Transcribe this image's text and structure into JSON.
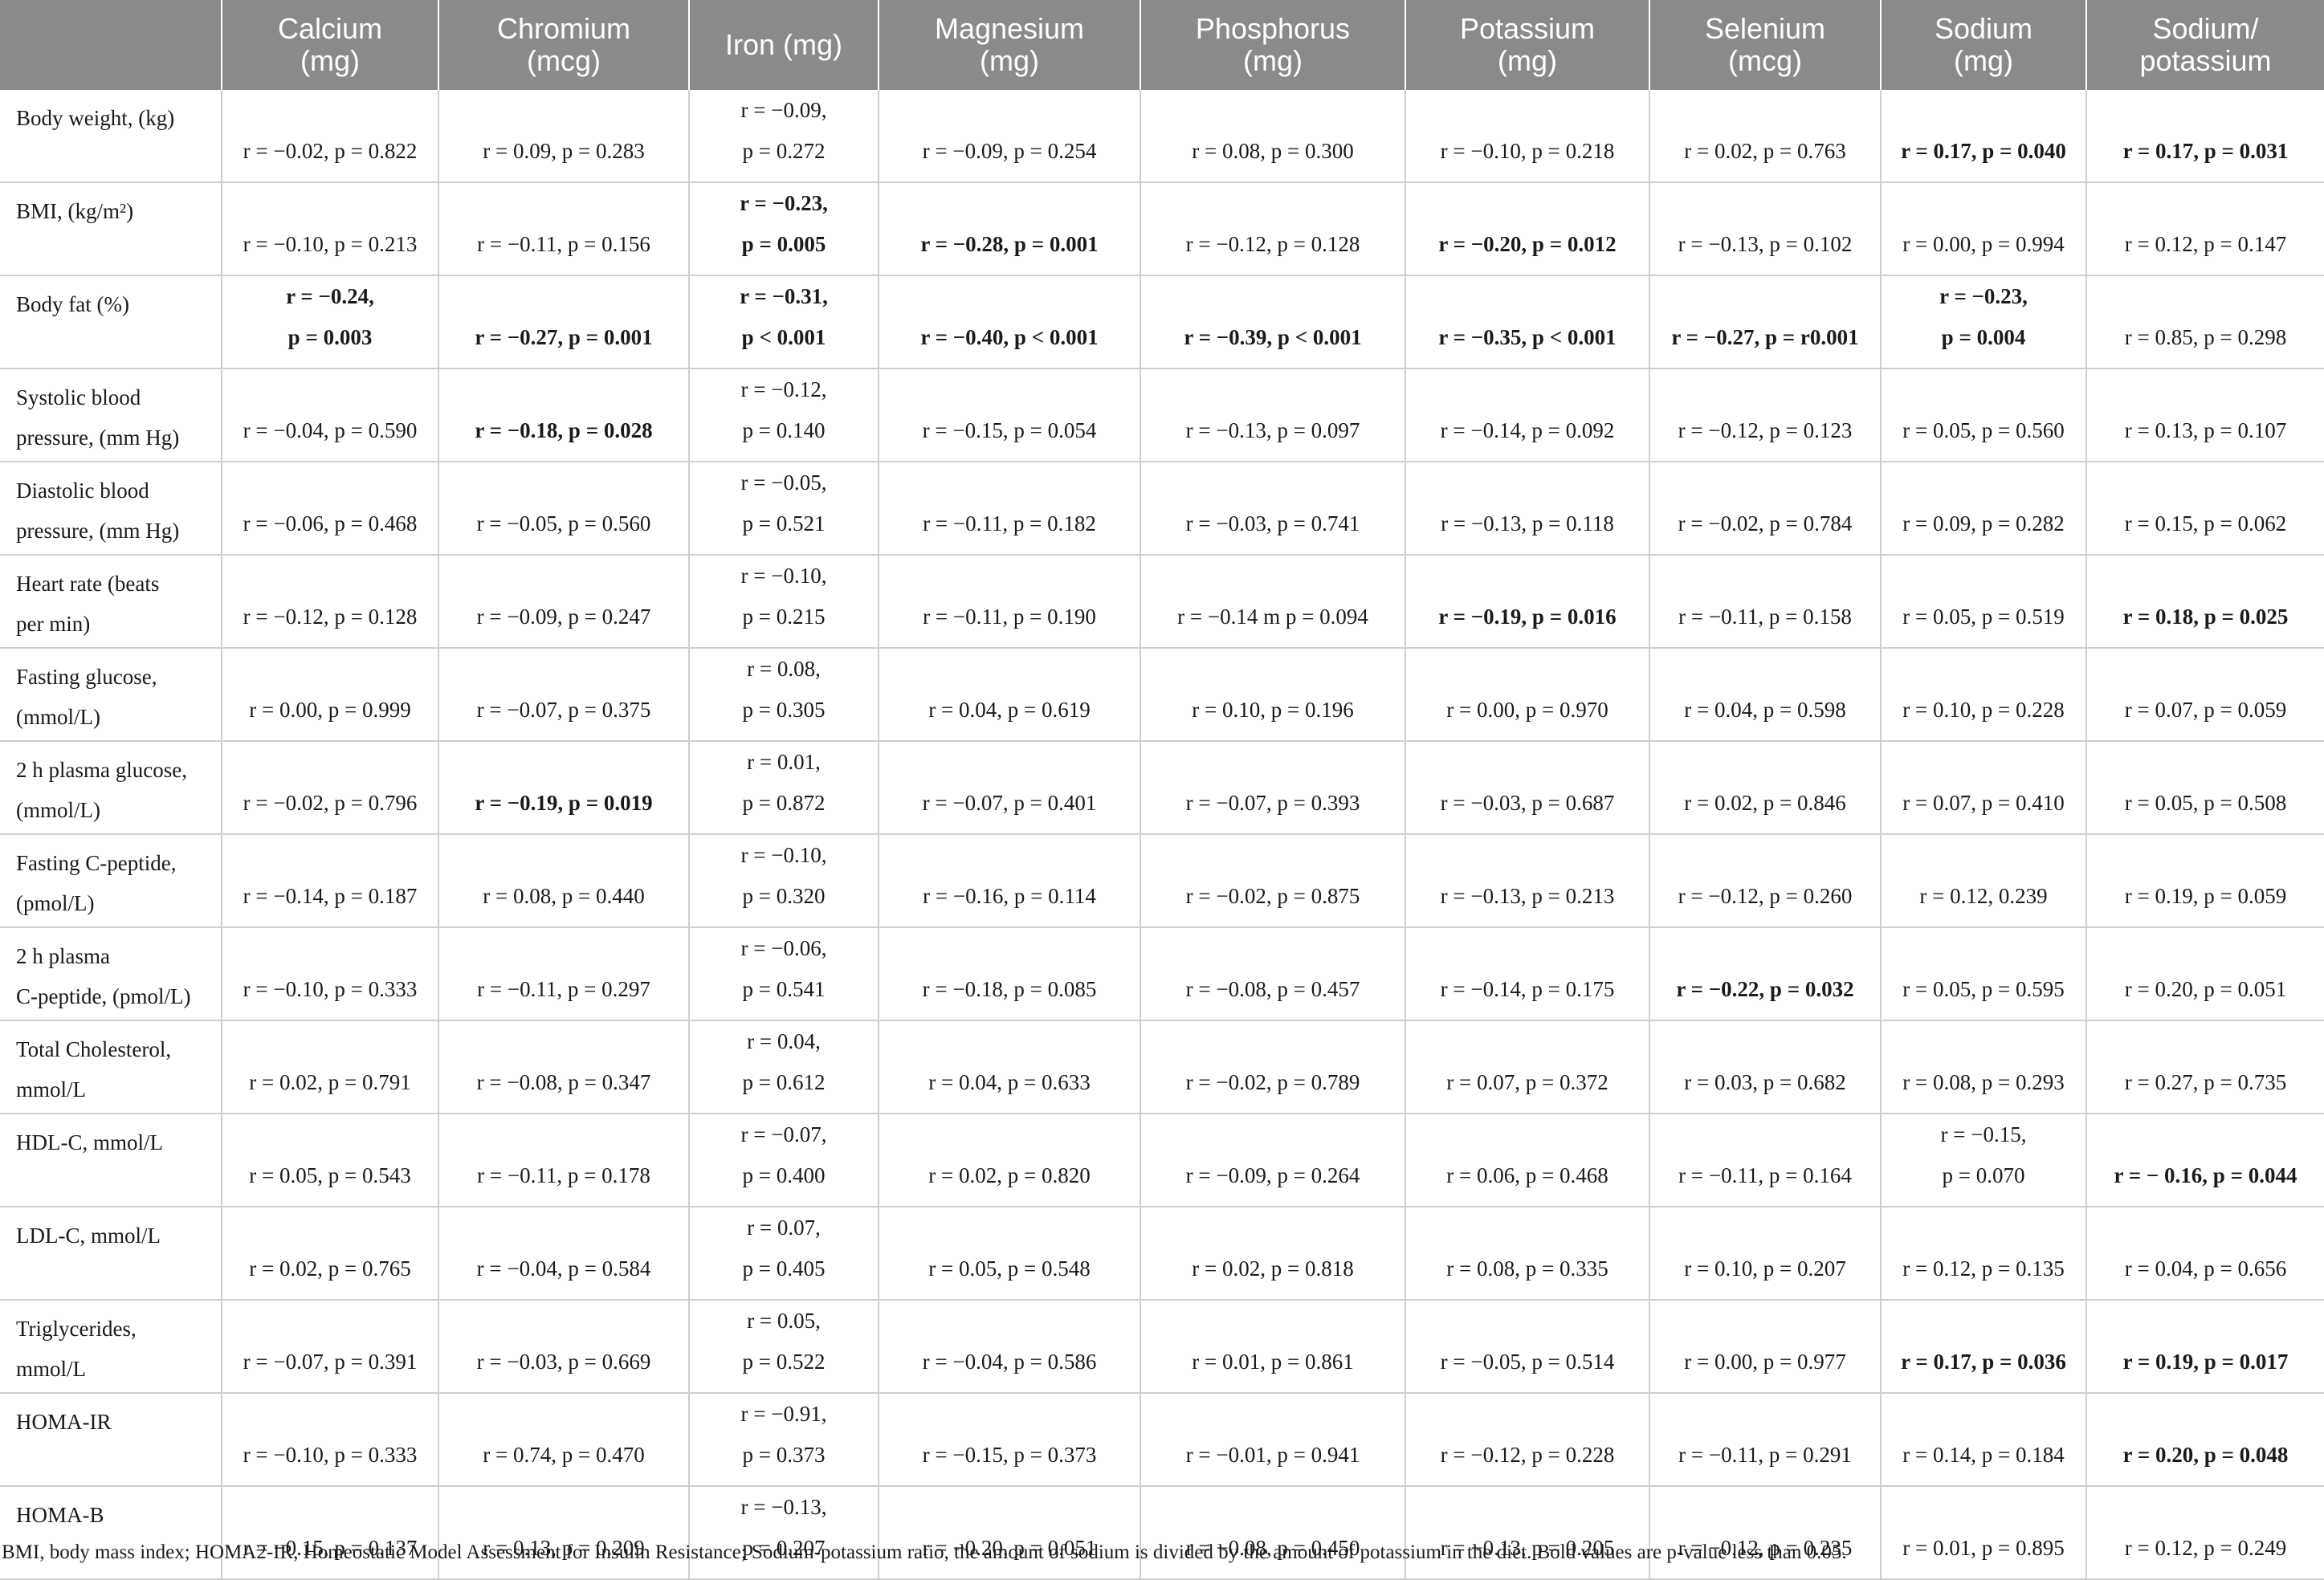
{
  "table": {
    "headers": [
      "",
      "Calcium\n(mg)",
      "Chromium\n(mcg)",
      "Iron (mg)",
      "Magnesium\n(mg)",
      "Phosphorus\n(mg)",
      "Potassium\n(mg)",
      "Selenium\n(mcg)",
      "Sodium\n(mg)",
      "Sodium/\npotassium"
    ],
    "rows": [
      {
        "label": "Body weight, (kg)",
        "cells": [
          {
            "text": "r = −0.02, p = 0.822",
            "bold": false,
            "split": false
          },
          {
            "text": "r = 0.09, p = 0.283",
            "bold": false,
            "split": false
          },
          {
            "text": "r = −0.09,\np = 0.272",
            "bold": false,
            "split": true
          },
          {
            "text": "r = −0.09, p = 0.254",
            "bold": false,
            "split": false
          },
          {
            "text": "r = 0.08, p = 0.300",
            "bold": false,
            "split": false
          },
          {
            "text": "r = −0.10, p = 0.218",
            "bold": false,
            "split": false
          },
          {
            "text": "r = 0.02, p = 0.763",
            "bold": false,
            "split": false
          },
          {
            "text": "r = 0.17, p = 0.040",
            "bold": true,
            "split": false
          },
          {
            "text": "r = 0.17, p = 0.031",
            "bold": true,
            "split": false
          }
        ]
      },
      {
        "label": "BMI, (kg/m²)",
        "cells": [
          {
            "text": "r = −0.10, p = 0.213",
            "bold": false,
            "split": false
          },
          {
            "text": "r = −0.11, p = 0.156",
            "bold": false,
            "split": false
          },
          {
            "text": "r = −0.23,\np = 0.005",
            "bold": true,
            "split": true
          },
          {
            "text": "r = −0.28, p = 0.001",
            "bold": true,
            "split": false
          },
          {
            "text": "r = −0.12, p = 0.128",
            "bold": false,
            "split": false
          },
          {
            "text": "r = −0.20, p = 0.012",
            "bold": true,
            "split": false
          },
          {
            "text": "r = −0.13, p = 0.102",
            "bold": false,
            "split": false
          },
          {
            "text": "r = 0.00, p = 0.994",
            "bold": false,
            "split": false
          },
          {
            "text": "r = 0.12, p = 0.147",
            "bold": false,
            "split": false
          }
        ]
      },
      {
        "label": "Body fat (%)",
        "cells": [
          {
            "text": "r = −0.24,\np = 0.003",
            "bold": true,
            "split": true
          },
          {
            "text": "r = −0.27, p = 0.001",
            "bold": true,
            "split": false
          },
          {
            "text": "r = −0.31,\np < 0.001",
            "bold": true,
            "split": true
          },
          {
            "text": "r = −0.40, p < 0.001",
            "bold": true,
            "split": false
          },
          {
            "text": "r = −0.39, p < 0.001",
            "bold": true,
            "split": false
          },
          {
            "text": "r = −0.35, p < 0.001",
            "bold": true,
            "split": false
          },
          {
            "text": "r = −0.27, p = r0.001",
            "bold": true,
            "split": false
          },
          {
            "text": "r = −0.23,\np = 0.004",
            "bold": true,
            "split": true
          },
          {
            "text": "r = 0.85, p = 0.298",
            "bold": false,
            "split": false
          }
        ]
      },
      {
        "label": "Systolic blood\npressure, (mm Hg)",
        "cells": [
          {
            "text": "r = −0.04, p = 0.590",
            "bold": false,
            "split": false
          },
          {
            "text": "r = −0.18, p = 0.028",
            "bold": true,
            "split": false
          },
          {
            "text": "r = −0.12,\np = 0.140",
            "bold": false,
            "split": true
          },
          {
            "text": "r = −0.15, p = 0.054",
            "bold": false,
            "split": false
          },
          {
            "text": "r = −0.13, p = 0.097",
            "bold": false,
            "split": false
          },
          {
            "text": "r = −0.14, p = 0.092",
            "bold": false,
            "split": false
          },
          {
            "text": "r = −0.12, p = 0.123",
            "bold": false,
            "split": false
          },
          {
            "text": "r = 0.05, p = 0.560",
            "bold": false,
            "split": false
          },
          {
            "text": "r = 0.13, p = 0.107",
            "bold": false,
            "split": false
          }
        ]
      },
      {
        "label": "Diastolic blood\npressure, (mm Hg)",
        "cells": [
          {
            "text": "r = −0.06, p = 0.468",
            "bold": false,
            "split": false
          },
          {
            "text": "r = −0.05, p = 0.560",
            "bold": false,
            "split": false
          },
          {
            "text": "r = −0.05,\np = 0.521",
            "bold": false,
            "split": true
          },
          {
            "text": "r = −0.11, p = 0.182",
            "bold": false,
            "split": false
          },
          {
            "text": "r = −0.03, p = 0.741",
            "bold": false,
            "split": false
          },
          {
            "text": "r = −0.13, p = 0.118",
            "bold": false,
            "split": false
          },
          {
            "text": "r = −0.02, p = 0.784",
            "bold": false,
            "split": false
          },
          {
            "text": "r = 0.09, p = 0.282",
            "bold": false,
            "split": false
          },
          {
            "text": "r = 0.15, p = 0.062",
            "bold": false,
            "split": false
          }
        ]
      },
      {
        "label": "Heart rate (beats\nper min)",
        "cells": [
          {
            "text": "r = −0.12, p = 0.128",
            "bold": false,
            "split": false
          },
          {
            "text": "r = −0.09, p = 0.247",
            "bold": false,
            "split": false
          },
          {
            "text": "r = −0.10,\np = 0.215",
            "bold": false,
            "split": true
          },
          {
            "text": "r = −0.11, p = 0.190",
            "bold": false,
            "split": false
          },
          {
            "text": "r = −0.14 m p = 0.094",
            "bold": false,
            "split": false
          },
          {
            "text": "r = −0.19, p = 0.016",
            "bold": true,
            "split": false
          },
          {
            "text": "r = −0.11, p = 0.158",
            "bold": false,
            "split": false
          },
          {
            "text": "r = 0.05, p = 0.519",
            "bold": false,
            "split": false
          },
          {
            "text": "r = 0.18, p = 0.025",
            "bold": true,
            "split": false
          }
        ]
      },
      {
        "label": "Fasting glucose,\n(mmol/L)",
        "cells": [
          {
            "text": "r = 0.00, p = 0.999",
            "bold": false,
            "split": false
          },
          {
            "text": "r = −0.07, p = 0.375",
            "bold": false,
            "split": false
          },
          {
            "text": "r = 0.08,\np = 0.305",
            "bold": false,
            "split": true
          },
          {
            "text": "r = 0.04, p = 0.619",
            "bold": false,
            "split": false
          },
          {
            "text": "r = 0.10, p = 0.196",
            "bold": false,
            "split": false
          },
          {
            "text": "r = 0.00, p = 0.970",
            "bold": false,
            "split": false
          },
          {
            "text": "r = 0.04, p = 0.598",
            "bold": false,
            "split": false
          },
          {
            "text": "r = 0.10, p = 0.228",
            "bold": false,
            "split": false
          },
          {
            "text": "r = 0.07, p = 0.059",
            "bold": false,
            "split": false
          }
        ]
      },
      {
        "label": "2 h plasma glucose,\n(mmol/L)",
        "cells": [
          {
            "text": "r = −0.02, p = 0.796",
            "bold": false,
            "split": false
          },
          {
            "text": "r = −0.19, p = 0.019",
            "bold": true,
            "split": false
          },
          {
            "text": "r = 0.01,\np = 0.872",
            "bold": false,
            "split": true
          },
          {
            "text": "r = −0.07, p = 0.401",
            "bold": false,
            "split": false
          },
          {
            "text": "r = −0.07, p = 0.393",
            "bold": false,
            "split": false
          },
          {
            "text": "r = −0.03, p = 0.687",
            "bold": false,
            "split": false
          },
          {
            "text": "r = 0.02, p = 0.846",
            "bold": false,
            "split": false
          },
          {
            "text": "r = 0.07, p = 0.410",
            "bold": false,
            "split": false
          },
          {
            "text": "r = 0.05, p = 0.508",
            "bold": false,
            "split": false
          }
        ]
      },
      {
        "label": "Fasting C-peptide,\n(pmol/L)",
        "cells": [
          {
            "text": "r = −0.14, p = 0.187",
            "bold": false,
            "split": false
          },
          {
            "text": "r = 0.08, p = 0.440",
            "bold": false,
            "split": false
          },
          {
            "text": "r = −0.10,\np = 0.320",
            "bold": false,
            "split": true
          },
          {
            "text": "r = −0.16, p = 0.114",
            "bold": false,
            "split": false
          },
          {
            "text": "r = −0.02, p = 0.875",
            "bold": false,
            "split": false
          },
          {
            "text": "r = −0.13, p = 0.213",
            "bold": false,
            "split": false
          },
          {
            "text": "r = −0.12, p = 0.260",
            "bold": false,
            "split": false
          },
          {
            "text": "r = 0.12, 0.239",
            "bold": false,
            "split": false
          },
          {
            "text": "r = 0.19, p = 0.059",
            "bold": false,
            "split": false
          }
        ]
      },
      {
        "label": "2 h plasma\nC-peptide, (pmol/L)",
        "cells": [
          {
            "text": "r = −0.10, p = 0.333",
            "bold": false,
            "split": false
          },
          {
            "text": "r = −0.11, p = 0.297",
            "bold": false,
            "split": false
          },
          {
            "text": "r = −0.06,\np = 0.541",
            "bold": false,
            "split": true
          },
          {
            "text": "r = −0.18, p = 0.085",
            "bold": false,
            "split": false
          },
          {
            "text": "r = −0.08, p = 0.457",
            "bold": false,
            "split": false
          },
          {
            "text": "r = −0.14, p = 0.175",
            "bold": false,
            "split": false
          },
          {
            "text": "r = −0.22, p = 0.032",
            "bold": true,
            "split": false
          },
          {
            "text": "r = 0.05, p = 0.595",
            "bold": false,
            "split": false
          },
          {
            "text": "r = 0.20, p = 0.051",
            "bold": false,
            "split": false
          }
        ]
      },
      {
        "label": "Total Cholesterol,\nmmol/L",
        "cells": [
          {
            "text": "r = 0.02, p = 0.791",
            "bold": false,
            "split": false
          },
          {
            "text": "r = −0.08, p = 0.347",
            "bold": false,
            "split": false
          },
          {
            "text": "r = 0.04,\np = 0.612",
            "bold": false,
            "split": true
          },
          {
            "text": "r = 0.04, p = 0.633",
            "bold": false,
            "split": false
          },
          {
            "text": "r = −0.02, p = 0.789",
            "bold": false,
            "split": false
          },
          {
            "text": "r = 0.07, p = 0.372",
            "bold": false,
            "split": false
          },
          {
            "text": "r = 0.03, p = 0.682",
            "bold": false,
            "split": false
          },
          {
            "text": "r = 0.08, p = 0.293",
            "bold": false,
            "split": false
          },
          {
            "text": "r = 0.27, p = 0.735",
            "bold": false,
            "split": false
          }
        ]
      },
      {
        "label": "HDL-C, mmol/L",
        "cells": [
          {
            "text": "r = 0.05, p = 0.543",
            "bold": false,
            "split": false
          },
          {
            "text": "r = −0.11, p = 0.178",
            "bold": false,
            "split": false
          },
          {
            "text": "r = −0.07,\np = 0.400",
            "bold": false,
            "split": true
          },
          {
            "text": "r = 0.02, p = 0.820",
            "bold": false,
            "split": false
          },
          {
            "text": "r = −0.09, p = 0.264",
            "bold": false,
            "split": false
          },
          {
            "text": "r = 0.06, p = 0.468",
            "bold": false,
            "split": false
          },
          {
            "text": "r = −0.11, p = 0.164",
            "bold": false,
            "split": false
          },
          {
            "text": "r = −0.15,\np = 0.070",
            "bold": false,
            "split": true
          },
          {
            "text": "r = − 0.16, p = 0.044",
            "bold": true,
            "split": false
          }
        ]
      },
      {
        "label": "LDL-C, mmol/L",
        "cells": [
          {
            "text": "r = 0.02, p = 0.765",
            "bold": false,
            "split": false
          },
          {
            "text": "r = −0.04, p = 0.584",
            "bold": false,
            "split": false
          },
          {
            "text": "r = 0.07,\np = 0.405",
            "bold": false,
            "split": true
          },
          {
            "text": "r = 0.05, p = 0.548",
            "bold": false,
            "split": false
          },
          {
            "text": "r = 0.02, p = 0.818",
            "bold": false,
            "split": false
          },
          {
            "text": "r = 0.08, p = 0.335",
            "bold": false,
            "split": false
          },
          {
            "text": "r = 0.10, p = 0.207",
            "bold": false,
            "split": false
          },
          {
            "text": "r = 0.12, p = 0.135",
            "bold": false,
            "split": false
          },
          {
            "text": "r = 0.04, p = 0.656",
            "bold": false,
            "split": false
          }
        ]
      },
      {
        "label": "Triglycerides,\nmmol/L",
        "cells": [
          {
            "text": "r = −0.07, p = 0.391",
            "bold": false,
            "split": false
          },
          {
            "text": "r = −0.03, p = 0.669",
            "bold": false,
            "split": false
          },
          {
            "text": "r = 0.05,\np = 0.522",
            "bold": false,
            "split": true
          },
          {
            "text": "r = −0.04, p = 0.586",
            "bold": false,
            "split": false
          },
          {
            "text": "r = 0.01, p = 0.861",
            "bold": false,
            "split": false
          },
          {
            "text": "r = −0.05, p = 0.514",
            "bold": false,
            "split": false
          },
          {
            "text": "r = 0.00, p = 0.977",
            "bold": false,
            "split": false
          },
          {
            "text": "r = 0.17, p = 0.036",
            "bold": true,
            "split": false
          },
          {
            "text": "r = 0.19, p = 0.017",
            "bold": true,
            "split": false
          }
        ]
      },
      {
        "label": "HOMA-IR",
        "cells": [
          {
            "text": "r = −0.10, p = 0.333",
            "bold": false,
            "split": false
          },
          {
            "text": "r = 0.74, p = 0.470",
            "bold": false,
            "split": false
          },
          {
            "text": "r = −0.91,\np = 0.373",
            "bold": false,
            "split": true
          },
          {
            "text": "r = −0.15, p = 0.373",
            "bold": false,
            "split": false
          },
          {
            "text": "r = −0.01, p = 0.941",
            "bold": false,
            "split": false
          },
          {
            "text": "r = −0.12, p = 0.228",
            "bold": false,
            "split": false
          },
          {
            "text": "r = −0.11, p = 0.291",
            "bold": false,
            "split": false
          },
          {
            "text": "r = 0.14, p = 0.184",
            "bold": false,
            "split": false
          },
          {
            "text": "r = 0.20, p = 0.048",
            "bold": true,
            "split": false
          }
        ]
      },
      {
        "label": "HOMA-B",
        "cells": [
          {
            "text": "r = −0.15, p = 0.137",
            "bold": false,
            "split": false
          },
          {
            "text": "r = 0.13, p = 0.209",
            "bold": false,
            "split": false
          },
          {
            "text": "r = −0.13,\np = 0.207",
            "bold": false,
            "split": true
          },
          {
            "text": "r = −0.20, p = 0.051",
            "bold": false,
            "split": false
          },
          {
            "text": "r = −0.08, p = 0.450",
            "bold": false,
            "split": false
          },
          {
            "text": "r = −0.13, p = 0.205",
            "bold": false,
            "split": false
          },
          {
            "text": "r = −0.12, p = 0.235",
            "bold": false,
            "split": false
          },
          {
            "text": "r = 0.01, p = 0.895",
            "bold": false,
            "split": false
          },
          {
            "text": "r = 0.12, p = 0.249",
            "bold": false,
            "split": false
          }
        ]
      }
    ]
  },
  "footnote": "BMI, body mass index; HOMA2-IR, Homeostatic Model Assessment for Insulin Resistance; Sodium-potassium ratio, the amount of sodium is divided by the amount of potassium in the diet. Bold values are p-value less than 0.05."
}
